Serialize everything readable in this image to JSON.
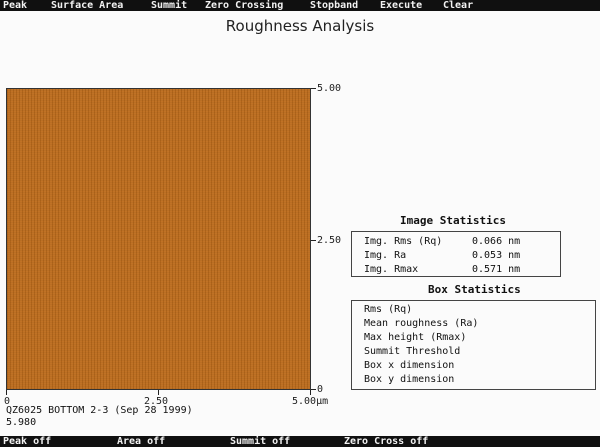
{
  "menu": [
    "Peak",
    "Surface Area",
    "Summit",
    "Zero Crossing",
    "Stopband",
    "Execute",
    "Clear"
  ],
  "title": "Roughness Analysis",
  "axes": {
    "x_ticks": [
      "0",
      "2.50",
      "5.00"
    ],
    "x_unit": "µm",
    "y_ticks": [
      "5.00",
      "2.50",
      "0"
    ]
  },
  "caption": "QZ6025 BOTTOM 2-3 (Sep 28 1999)",
  "value": "5.980",
  "image_stats": {
    "title": "Image Statistics",
    "rows": [
      {
        "label": "Img. Rms (Rq)",
        "value": "0.066 nm"
      },
      {
        "label": "Img. Ra",
        "value": "0.053 nm"
      },
      {
        "label": "Img. Rmax",
        "value": "0.571 nm"
      }
    ]
  },
  "box_stats": {
    "title": "Box Statistics",
    "rows": [
      "Rms (Rq)",
      "Mean roughness (Ra)",
      "Max height (Rmax)",
      "Summit Threshold",
      "Box x dimension",
      "Box y dimension"
    ]
  },
  "status": [
    "Peak off",
    "Area off",
    "Summit off",
    "Zero Cross off"
  ],
  "colors": {
    "image": "#bd6c1c",
    "bar": "#101010"
  }
}
